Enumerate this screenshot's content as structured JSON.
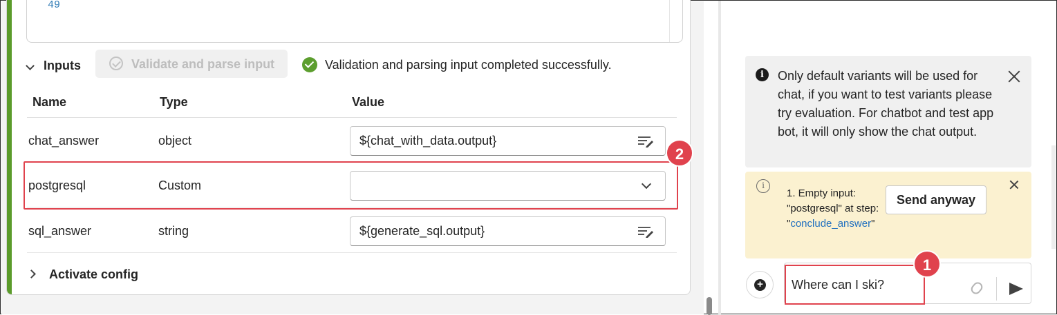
{
  "code": {
    "line_number": "49"
  },
  "inputs_section": {
    "label": "Inputs",
    "validate_button": "Validate and parse input",
    "success_message": "Validation and parsing input completed successfully."
  },
  "table": {
    "headers": {
      "name": "Name",
      "type": "Type",
      "value": "Value"
    },
    "rows": [
      {
        "name": "chat_answer",
        "type": "object",
        "value": "${chat_with_data.output}"
      },
      {
        "name": "postgresql",
        "type": "Custom",
        "value": ""
      },
      {
        "name": "sql_answer",
        "type": "string",
        "value": "${generate_sql.output}"
      }
    ]
  },
  "activate_config": {
    "label": "Activate config"
  },
  "badges": {
    "one": "1",
    "two": "2"
  },
  "chat": {
    "info_message": "Only default variants will be used for chat, if you want to test variants please try evaluation. For chatbot and test app bot, it will only show the chat output.",
    "warning": {
      "prefix": "1. Empty input: \"postgresql\" at step: \"",
      "link": "conclude_answer",
      "suffix": "\"",
      "send_anyway": "Send anyway"
    },
    "input_value": "Where can I ski?"
  },
  "colors": {
    "accent_green": "#5b9b2b",
    "highlight_red": "#e0424d",
    "warning_bg": "#fbf1d0",
    "link_blue": "#1f6fbf"
  },
  "icons": [
    "chevron-down-icon",
    "validate-icon",
    "checkmark-circle-icon",
    "edit-text-icon",
    "chevron-right-icon",
    "info-icon",
    "close-icon",
    "new-chat-icon",
    "attach-icon",
    "send-icon"
  ]
}
